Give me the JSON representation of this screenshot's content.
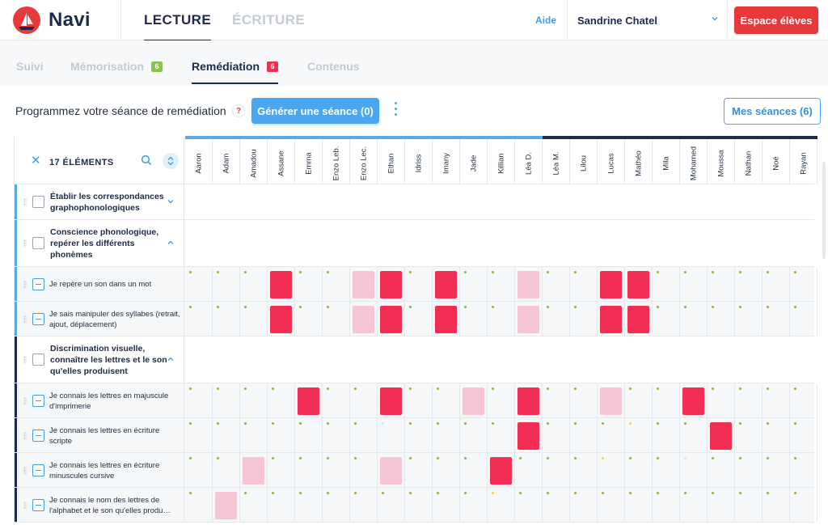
{
  "app": {
    "name": "Navi"
  },
  "main_tabs": [
    {
      "label": "LECTURE"
    },
    {
      "label": "ÉCRITURE"
    }
  ],
  "header": {
    "help": "Aide",
    "user": "Sandrine Chatel",
    "espace_button": "Espace élèves"
  },
  "sub_tabs": [
    {
      "label": "Suivi"
    },
    {
      "label": "Mémorisation",
      "badge": "6",
      "badge_color": "#8bc34a"
    },
    {
      "label": "Remédiation",
      "badge": "6",
      "badge_color": "#f0304f"
    },
    {
      "label": "Contenus"
    }
  ],
  "toolbar": {
    "title": "Programmez votre séance de remédiation",
    "help_mark": "?",
    "generate_button": "Générer une séance (0)",
    "sessions_button": "Mes séances (6)"
  },
  "grid": {
    "count_label": "17 ÉLÉMENTS",
    "close_mark": "✕",
    "students": [
      "Aaron",
      "Adam",
      "Amadou",
      "Assane",
      "Emma",
      "Enzo Leb.",
      "Enzo Lec.",
      "Ethan",
      "Idriss",
      "Imany",
      "Jade",
      "Killian",
      "Léa D.",
      "Léa M.",
      "Lilou",
      "Lucas",
      "Mathéo",
      "Mila",
      "Mohamed",
      "Moussa",
      "Nathan",
      "Noé",
      "Rayan"
    ],
    "colors": {
      "red": "#f12f55",
      "pink": "#f7c6d4",
      "green_dot": "#8bb54a",
      "yellow_dot": "#f2d03a",
      "accent": "#3e9ee8",
      "dark": "#1b2b4b"
    },
    "rows": [
      {
        "type": "domain",
        "label": "Établir les correspondances graphophonologiques",
        "expanded": false
      },
      {
        "type": "domain",
        "label": "Conscience phonologique, repérer les différents phonèmes",
        "expanded": true
      },
      {
        "type": "skill",
        "label": "Je repère un son dans un mot",
        "cells": "gg.rg.pr.r..p..rr.."
      },
      {
        "type": "skill",
        "label": "Je sais manipuler des syllabes (retrait, ajout, déplacement)",
        "cells": "gg.rg.pr.r..p..rr.."
      },
      {
        "type": "domain",
        "label": "Discrimination visuelle, connaître les lettres et le son qu'elles produisent",
        "expanded": true
      },
      {
        "type": "skill",
        "label": "Je connais les lettres en majuscule d'imprimerie",
        "cells": "ggg.r.gr.gp.r..p..r.."
      },
      {
        "type": "skill",
        "label": "Je connais les lettres en écriture scripte",
        "cells": "gggg.ggwggg.r.g.yg.r.."
      },
      {
        "type": "skill",
        "label": "Je connais les lettres en écriture minuscules cursive",
        "cells": "g.p.gggpgggr.g.yg.w.."
      },
      {
        "type": "skill",
        "label": "Je connais le nom des lettres de l'alphabet et le son qu'elles produ…",
        "cells": "gpgggggggggyggggggggg.."
      }
    ]
  }
}
